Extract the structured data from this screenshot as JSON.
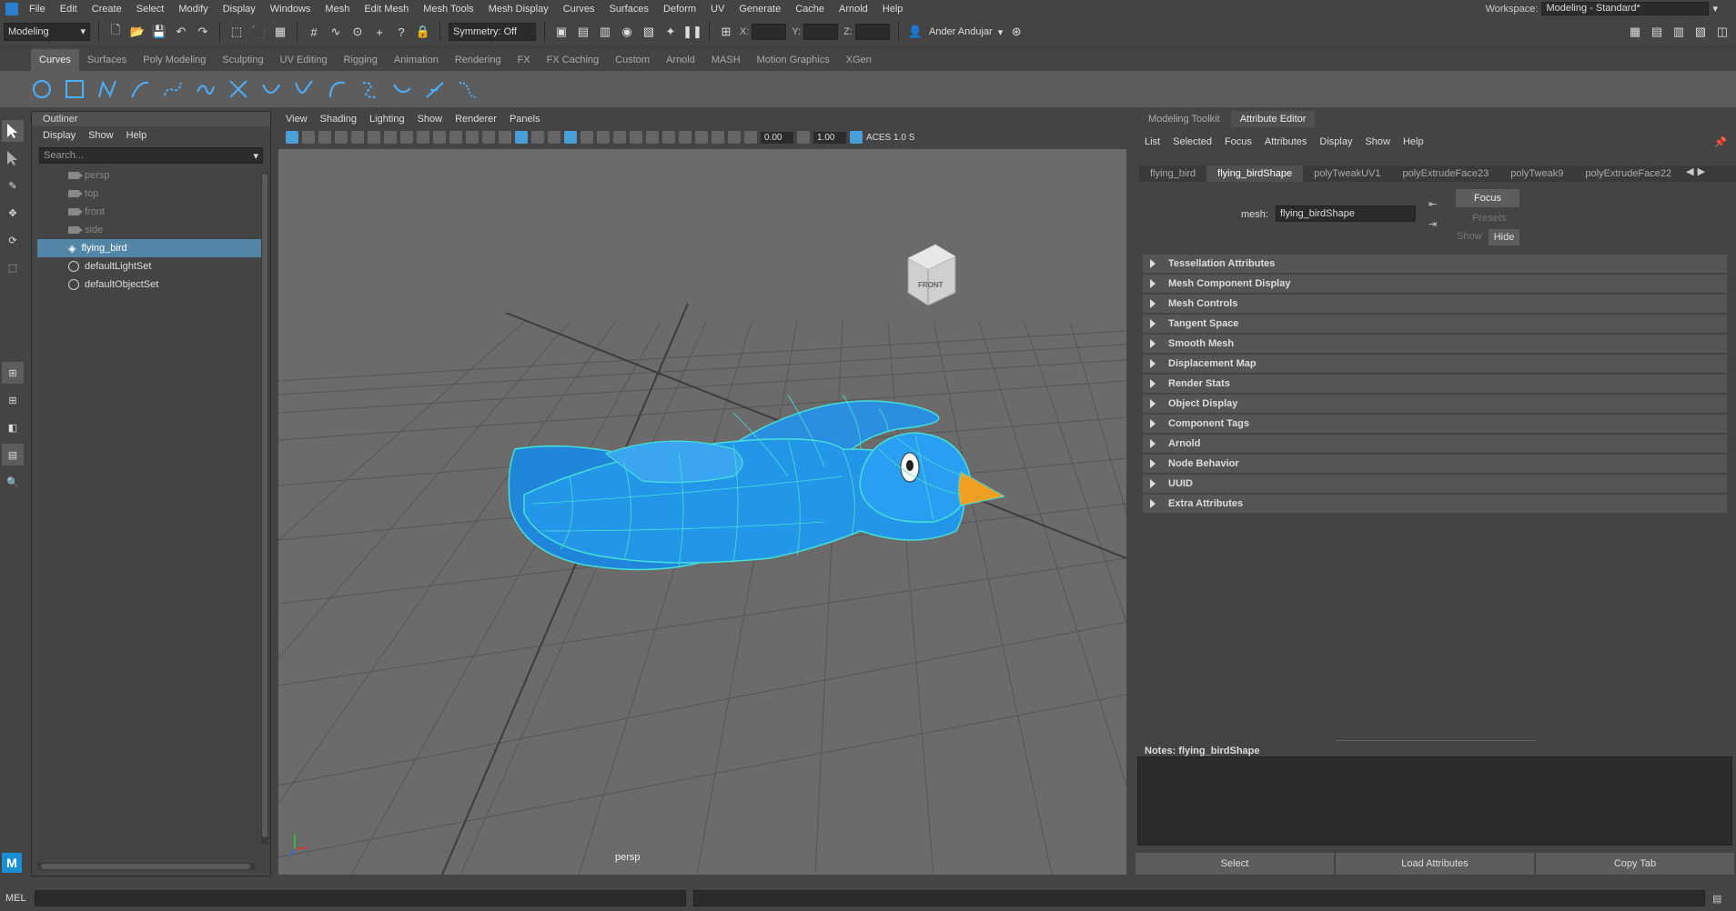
{
  "menubar": {
    "items": [
      "File",
      "Edit",
      "Create",
      "Select",
      "Modify",
      "Display",
      "Windows",
      "Mesh",
      "Edit Mesh",
      "Mesh Tools",
      "Mesh Display",
      "Curves",
      "Surfaces",
      "Deform",
      "UV",
      "Generate",
      "Cache",
      "Arnold",
      "Help"
    ],
    "workspace_label": "Workspace:",
    "workspace_value": "Modeling - Standard*"
  },
  "statusline": {
    "menuset": "Modeling",
    "symmetry": "Symmetry: Off",
    "x_label": "X:",
    "y_label": "Y:",
    "z_label": "Z:",
    "user": "Ander Andujar"
  },
  "shelf": {
    "tabs": [
      "Curves",
      "Surfaces",
      "Poly Modeling",
      "Sculpting",
      "UV Editing",
      "Rigging",
      "Animation",
      "Rendering",
      "FX",
      "FX Caching",
      "Custom",
      "Arnold",
      "MASH",
      "Motion Graphics",
      "XGen"
    ],
    "active_tab": "Curves"
  },
  "outliner": {
    "title": "Outliner",
    "menu": [
      "Display",
      "Show",
      "Help"
    ],
    "search_placeholder": "Search...",
    "items": [
      {
        "label": "persp",
        "type": "camera"
      },
      {
        "label": "top",
        "type": "camera"
      },
      {
        "label": "front",
        "type": "camera"
      },
      {
        "label": "side",
        "type": "camera"
      },
      {
        "label": "flying_bird",
        "type": "mesh"
      },
      {
        "label": "defaultLightSet",
        "type": "set"
      },
      {
        "label": "defaultObjectSet",
        "type": "set"
      }
    ],
    "selected": "flying_bird"
  },
  "viewport": {
    "menu": [
      "View",
      "Shading",
      "Lighting",
      "Show",
      "Renderer",
      "Panels"
    ],
    "exposure": "0.00",
    "gamma": "1.00",
    "colorspace": "ACES 1.0 S",
    "camera_label": "persp",
    "viewcube_label": "FRONT"
  },
  "attribute_editor": {
    "panel_tabs": [
      "Modeling Toolkit",
      "Attribute Editor"
    ],
    "active_panel_tab": "Attribute Editor",
    "menu": [
      "List",
      "Selected",
      "Focus",
      "Attributes",
      "Display",
      "Show",
      "Help"
    ],
    "node_tabs": [
      "flying_bird",
      "flying_birdShape",
      "polyTweakUV1",
      "polyExtrudeFace23",
      "polyTweak9",
      "polyExtrudeFace22"
    ],
    "active_node_tab": "flying_birdShape",
    "mesh_label": "mesh:",
    "mesh_value": "flying_birdShape",
    "focus_button": "Focus",
    "presets_button": "Presets",
    "show_label": "Show",
    "hide_button": "Hide",
    "sections": [
      "Tessellation Attributes",
      "Mesh Component Display",
      "Mesh Controls",
      "Tangent Space",
      "Smooth Mesh",
      "Displacement Map",
      "Render Stats",
      "Object Display",
      "Component Tags",
      "Arnold",
      "Node Behavior",
      "UUID",
      "Extra Attributes"
    ],
    "notes_label": "Notes:  flying_birdShape",
    "buttons": [
      "Select",
      "Load Attributes",
      "Copy Tab"
    ]
  },
  "commandline": {
    "language": "MEL"
  },
  "colors": {
    "selection": "#5285a6",
    "bird_body": "#2a8fe0",
    "beak": "#f0a020",
    "wireframe": "#45e0d8"
  }
}
